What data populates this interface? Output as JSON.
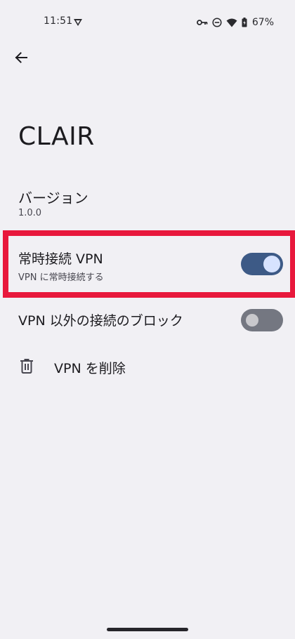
{
  "status_bar": {
    "time": "11:51",
    "battery_percent": "67%",
    "icons": [
      "app-notification-icon",
      "vpn-key-icon",
      "do-not-disturb-icon",
      "wifi-icon",
      "battery-icon"
    ]
  },
  "header": {
    "back_icon": "arrow-back-icon"
  },
  "page": {
    "title": "CLAIR"
  },
  "version": {
    "label": "バージョン",
    "value": "1.0.0"
  },
  "always_on_vpn": {
    "label": "常時接続 VPN",
    "description": "VPN に常時接続する",
    "enabled": true
  },
  "block_without_vpn": {
    "label": "VPN 以外の接続のブロック",
    "enabled": false
  },
  "delete_vpn": {
    "label": "VPN を削除",
    "icon": "trash-icon"
  },
  "colors": {
    "background": "#f1f0f4",
    "switch_on_track": "#3d5a86",
    "switch_on_thumb": "#d7e3ff",
    "switch_off_track": "#747781",
    "highlight_frame": "#e8183c"
  }
}
